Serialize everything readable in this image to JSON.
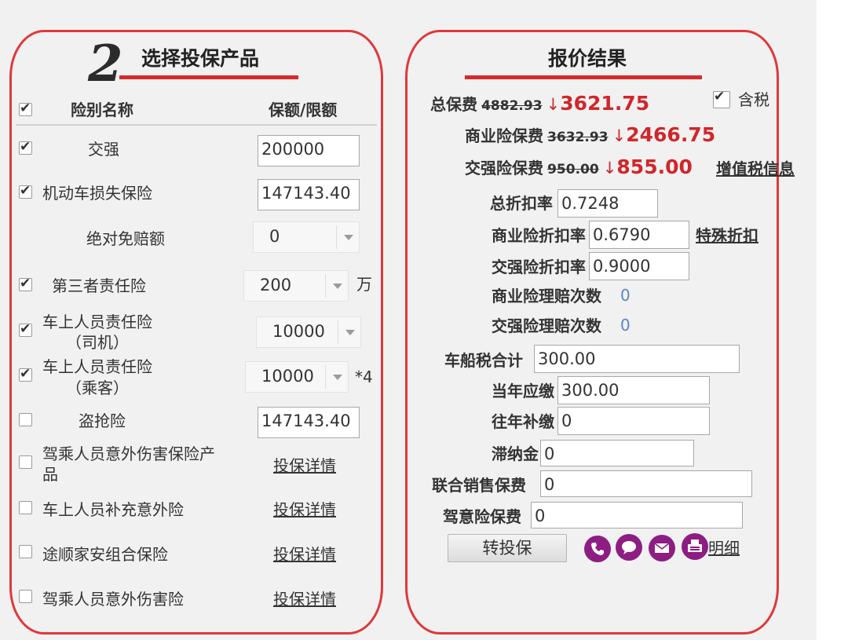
{
  "left": {
    "step_number": "2",
    "heading": "选择投保产品",
    "col_name": "险别名称",
    "col_amount": "保额/限额",
    "rows": {
      "jiaoqiang": {
        "label": "交强",
        "value": "200000"
      },
      "vehicle_loss": {
        "label": "机动车损失保险",
        "value": "147143.40"
      },
      "deductible": {
        "label": "绝对免赔额",
        "value": "0"
      },
      "third_party": {
        "label": "第三者责任险",
        "value": "200",
        "unit": "万"
      },
      "driver": {
        "label1": "车上人员责任险",
        "label2": "（司机）",
        "value": "10000"
      },
      "passenger": {
        "label1": "车上人员责任险",
        "label2": "（乘客）",
        "value": "10000",
        "suffix": "*4"
      },
      "theft": {
        "label": "盗抢险",
        "value": "147143.40"
      },
      "driver_accident": {
        "label1": "驾乘人员意外伤害保险产",
        "label2": "品",
        "link": "投保详情"
      },
      "supp_accident": {
        "label": "车上人员补充意外险",
        "link": "投保详情"
      },
      "tushun": {
        "label": "途顺家安组合保险",
        "link": "投保详情"
      },
      "driver_injury": {
        "label": "驾乘人员意外伤害险",
        "link": "投保详情"
      }
    }
  },
  "right": {
    "heading": "报价结果",
    "tax_included": "含税",
    "total": {
      "label": "总保费",
      "old": "4882.93",
      "arrow": "↓",
      "new": "3621.75"
    },
    "commercial": {
      "label": "商业险保费",
      "old": "3632.93",
      "arrow": "↓",
      "new": "2466.75"
    },
    "compulsory": {
      "label": "交强险保费",
      "old": "950.00",
      "arrow": "↓",
      "new": "855.00"
    },
    "vat_link": "增值税信息",
    "total_discount": {
      "label": "总折扣率",
      "value": "0.7248"
    },
    "commercial_discount": {
      "label": "商业险折扣率",
      "value": "0.6790",
      "link": "特殊折扣"
    },
    "compulsory_discount": {
      "label": "交强险折扣率",
      "value": "0.9000"
    },
    "commercial_claims": {
      "label": "商业险理赔次数",
      "value": "0"
    },
    "compulsory_claims": {
      "label": "交强险理赔次数",
      "value": "0"
    },
    "vessel_tax_total": {
      "label": "车船税合计",
      "value": "300.00"
    },
    "current_year_due": {
      "label": "当年应缴",
      "value": "300.00"
    },
    "prior_year_back": {
      "label": "往年补缴",
      "value": "0"
    },
    "late_fee": {
      "label": "滞纳金",
      "value": "0"
    },
    "joint_sales": {
      "label": "联合销售保费",
      "value": "0"
    },
    "accident_premium": {
      "label": "驾意险保费",
      "value": "0"
    },
    "transfer_button": "转投保",
    "detail_link": "明细",
    "icons": [
      "phone-icon",
      "chat-icon",
      "mail-icon",
      "fax-icon"
    ],
    "icon_color": "#8d1d82"
  },
  "accent_color": "#e0383a"
}
